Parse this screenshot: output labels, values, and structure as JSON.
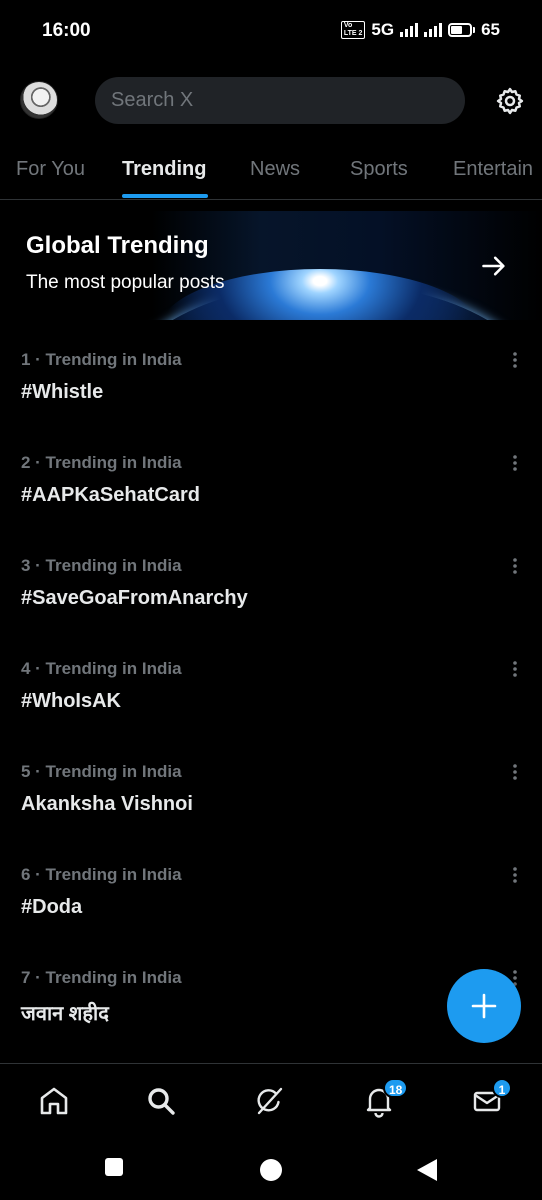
{
  "status_bar": {
    "time": "16:00",
    "volte_line1": "Vo",
    "volte_line2": "LTE 2",
    "network": "5G",
    "battery": "65"
  },
  "header": {
    "search_placeholder": "Search X"
  },
  "tabs": [
    {
      "label": "For You",
      "active": false
    },
    {
      "label": "Trending",
      "active": true
    },
    {
      "label": "News",
      "active": false
    },
    {
      "label": "Sports",
      "active": false
    },
    {
      "label": "Entertain",
      "active": false
    }
  ],
  "banner": {
    "title": "Global Trending",
    "subtitle": "The most popular posts"
  },
  "trends": [
    {
      "meta": "1 · Trending in India",
      "name": "#Whistle"
    },
    {
      "meta": "2 · Trending in India",
      "name": "#AAPKaSehatCard"
    },
    {
      "meta": "3 · Trending in India",
      "name": "#SaveGoaFromAnarchy"
    },
    {
      "meta": "4 · Trending in India",
      "name": "#WhoIsAK"
    },
    {
      "meta": "5 · Trending in India",
      "name": "Akanksha Vishnoi"
    },
    {
      "meta": "6 · Trending in India",
      "name": "#Doda"
    },
    {
      "meta": "7 · Trending in India",
      "name": "जवान शहीद"
    }
  ],
  "bottom_nav": {
    "notifications_badge": "18",
    "messages_badge": "1"
  },
  "colors": {
    "accent": "#1d9bf0",
    "background": "#000000",
    "secondary_text": "#71767b"
  },
  "icons": [
    "settings-icon",
    "arrow-right-icon",
    "more-icon",
    "plus-icon",
    "home-icon",
    "search-icon",
    "grok-icon",
    "bell-icon",
    "mail-icon"
  ]
}
